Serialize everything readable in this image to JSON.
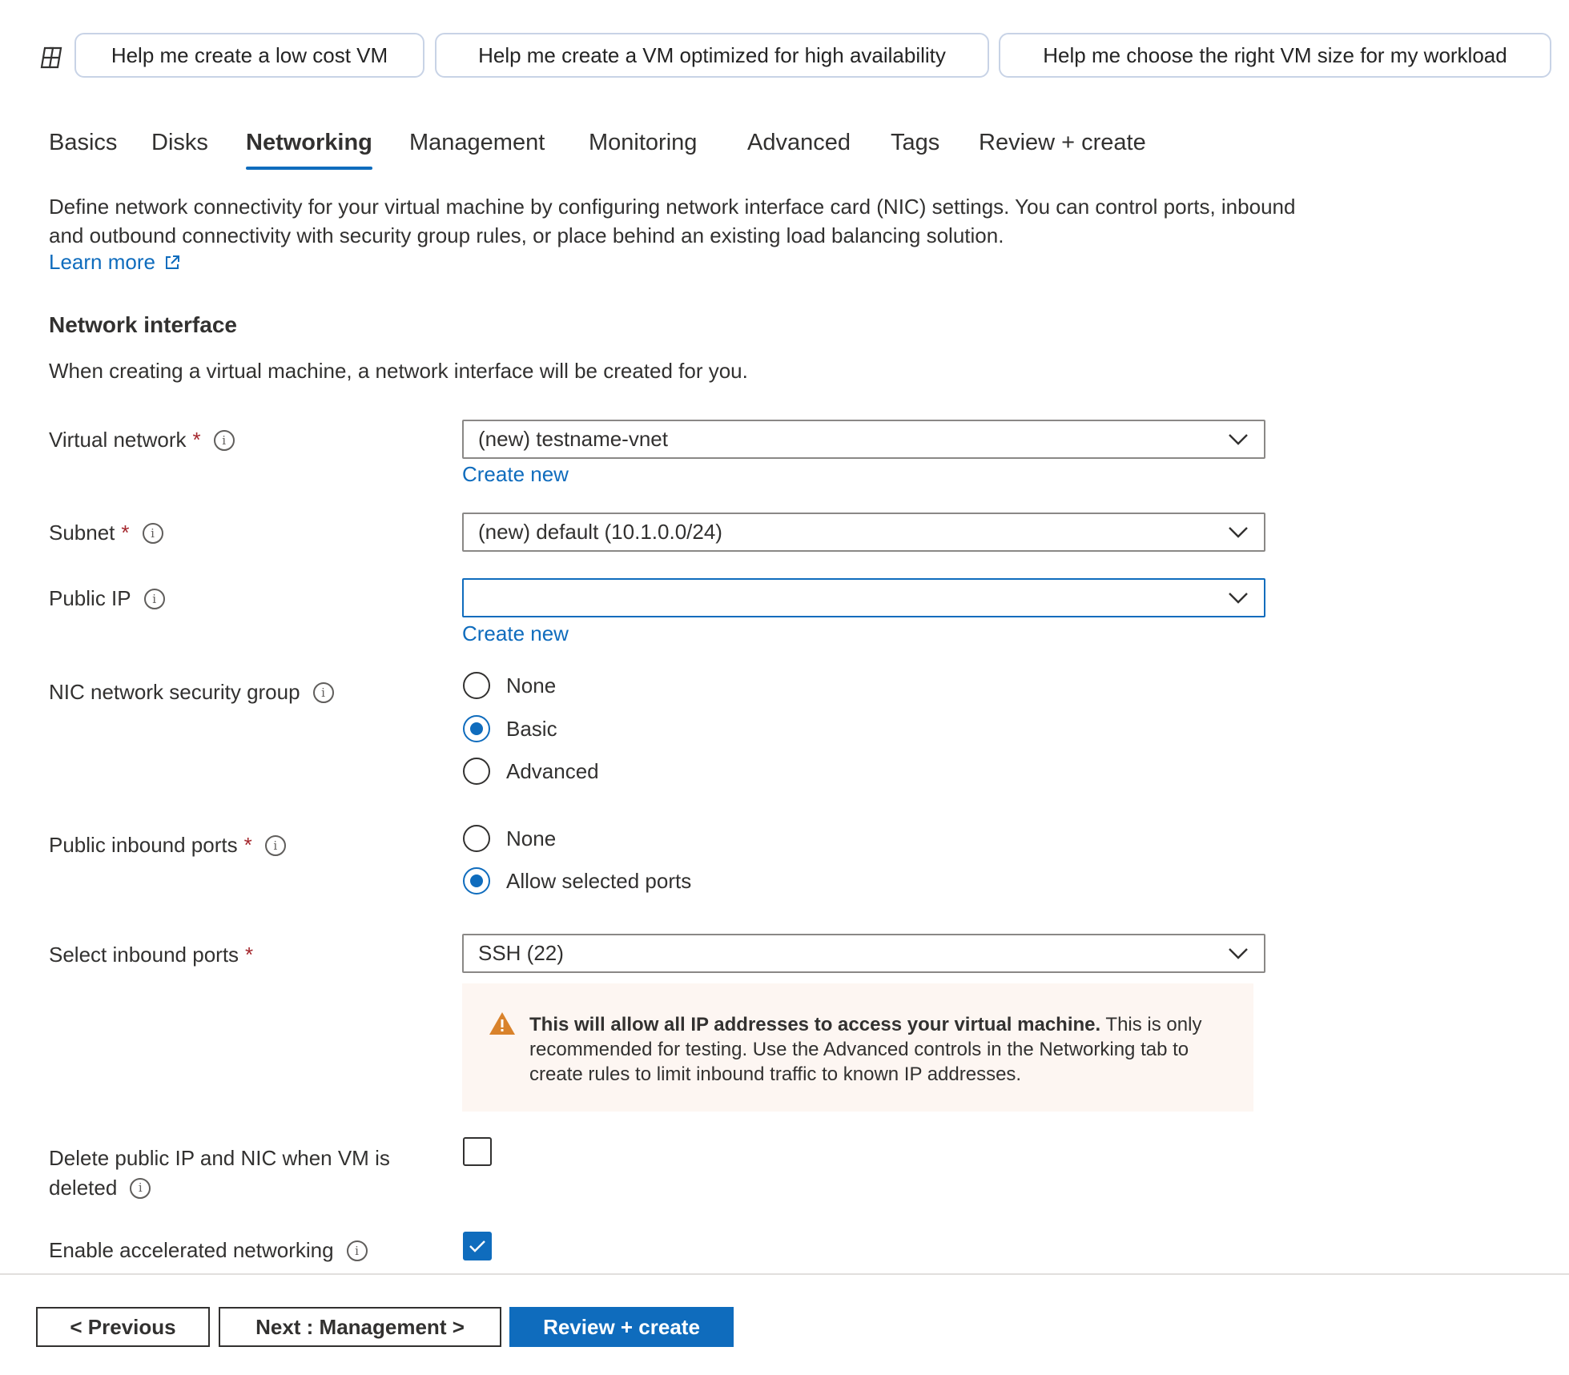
{
  "colors": {
    "accent": "#0f6cbd",
    "required": "#a4262c",
    "warning_bg": "#fdf6f2",
    "warning_icon": "#d9822b"
  },
  "suggestions": [
    "Help me create a low cost VM",
    "Help me create a VM optimized for high availability",
    "Help me choose the right VM size for my workload"
  ],
  "tabs": [
    {
      "label": "Basics"
    },
    {
      "label": "Disks"
    },
    {
      "label": "Networking",
      "active": true
    },
    {
      "label": "Management"
    },
    {
      "label": "Monitoring"
    },
    {
      "label": "Advanced"
    },
    {
      "label": "Tags"
    },
    {
      "label": "Review + create"
    }
  ],
  "intro": {
    "description": "Define network connectivity for your virtual machine by configuring network interface card (NIC) settings. You can control ports, inbound and outbound connectivity with security group rules, or place behind an existing load balancing solution.",
    "learn_more": "Learn more"
  },
  "network_interface": {
    "heading": "Network interface",
    "subtext": "When creating a virtual machine, a network interface will be created for you."
  },
  "fields": {
    "virtual_network": {
      "label": "Virtual network",
      "required": "*",
      "value": "(new) testname-vnet",
      "create_new": "Create new"
    },
    "subnet": {
      "label": "Subnet",
      "required": "*",
      "value": "(new) default (10.1.0.0/24)"
    },
    "public_ip": {
      "label": "Public IP",
      "value": "",
      "create_new": "Create new"
    },
    "nic_nsg": {
      "label": "NIC network security group",
      "options": [
        "None",
        "Basic",
        "Advanced"
      ],
      "selected": "Basic"
    },
    "public_inbound_ports": {
      "label": "Public inbound ports",
      "required": "*",
      "options": [
        "None",
        "Allow selected ports"
      ],
      "selected": "Allow selected ports"
    },
    "select_inbound_ports": {
      "label": "Select inbound ports",
      "required": "*",
      "value": "SSH (22)"
    },
    "delete_public_ip": {
      "label_line1": "Delete public IP and NIC when VM is",
      "label_line2": "deleted",
      "checked": false
    },
    "accelerated_networking": {
      "label": "Enable accelerated networking",
      "checked": true
    }
  },
  "warning": {
    "bold": "This will allow all IP addresses to access your virtual machine.",
    "text": "This is only recommended for testing.  Use the Advanced controls in the Networking tab to create rules to limit inbound traffic to known IP addresses."
  },
  "footer": {
    "previous": "< Previous",
    "next": "Next : Management >",
    "review": "Review + create"
  }
}
